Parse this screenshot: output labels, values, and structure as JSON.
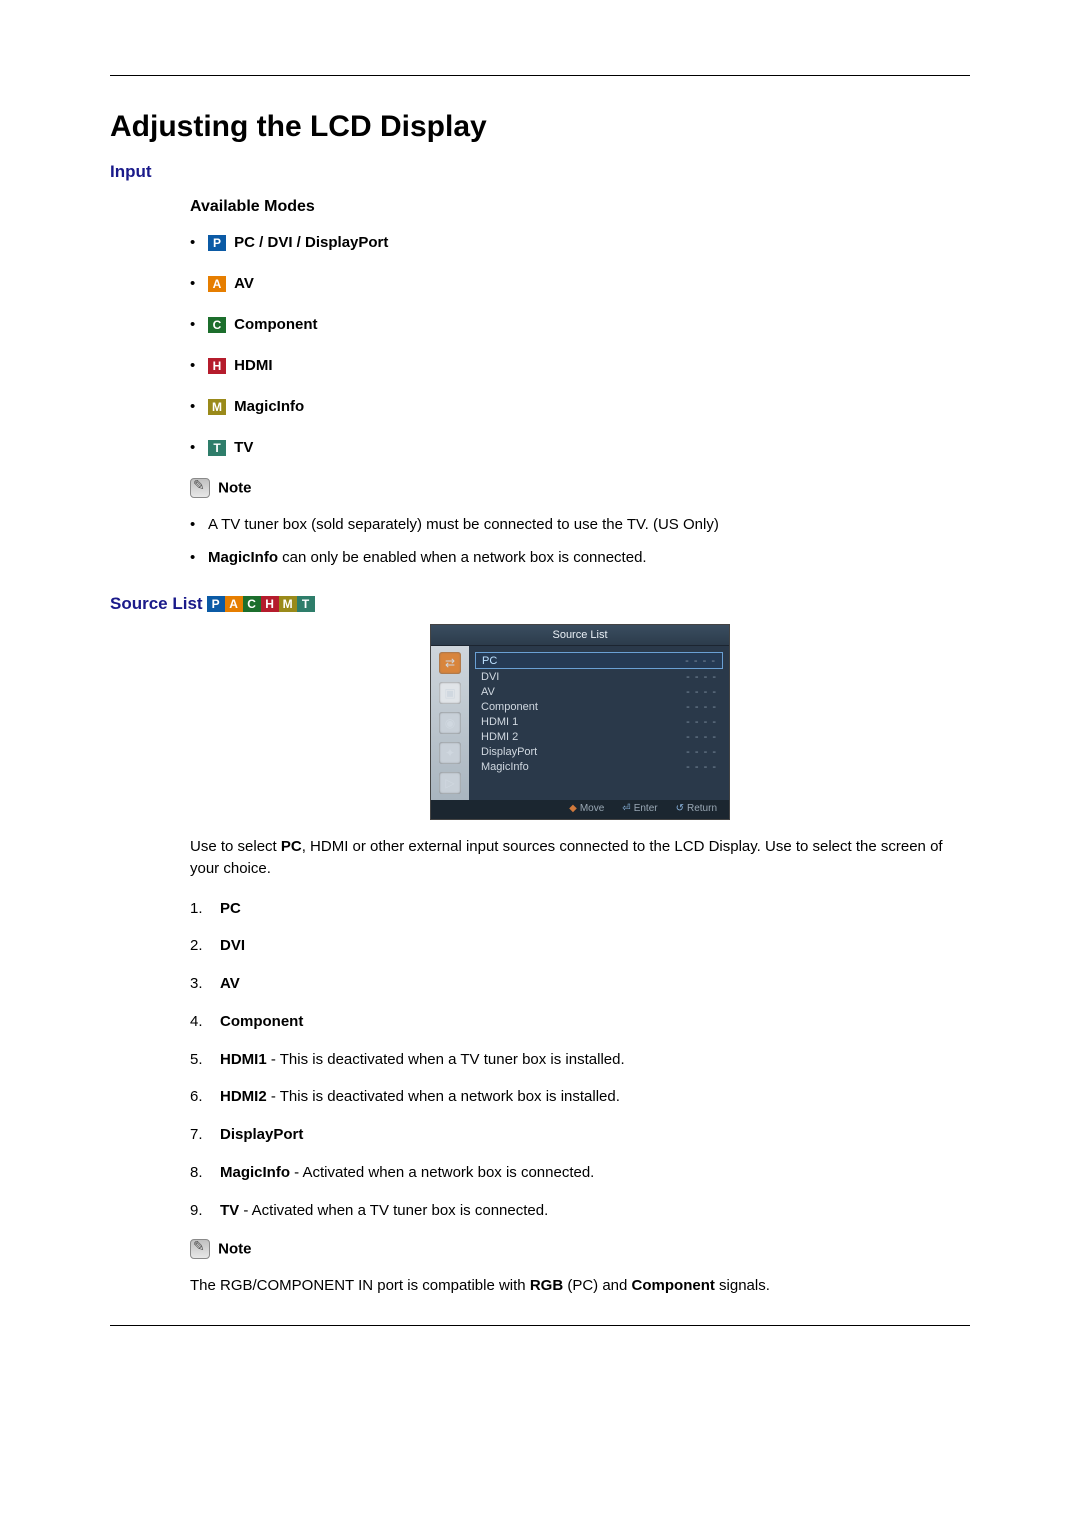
{
  "page_title": "Adjusting the LCD Display",
  "sections": {
    "input": {
      "heading": "Input",
      "available_modes_heading": "Available Modes",
      "modes": [
        {
          "badge": "P",
          "class": "b-P",
          "label": "PC / DVI / DisplayPort"
        },
        {
          "badge": "A",
          "class": "b-A",
          "label": "AV"
        },
        {
          "badge": "C",
          "class": "b-C",
          "label": "Component"
        },
        {
          "badge": "H",
          "class": "b-H",
          "label": "HDMI"
        },
        {
          "badge": "M",
          "class": "b-M",
          "label": "MagicInfo"
        },
        {
          "badge": "T",
          "class": "b-T",
          "label": "TV"
        }
      ],
      "note_label": "Note",
      "notes": [
        {
          "plain": "A TV tuner box (sold separately) must be connected to use the TV. (US Only)"
        },
        {
          "bold_prefix": "MagicInfo",
          "rest": " can only be enabled when a network box is connected."
        }
      ]
    },
    "source_list": {
      "heading": "Source List",
      "badges": [
        "P",
        "A",
        "C",
        "H",
        "M",
        "T"
      ],
      "osd": {
        "title": "Source List",
        "items": [
          {
            "label": "PC",
            "value": "- - - -",
            "selected": true
          },
          {
            "label": "DVI",
            "value": "- - - -",
            "selected": false
          },
          {
            "label": "AV",
            "value": "- - - -",
            "selected": false
          },
          {
            "label": "Component",
            "value": "- - - -",
            "selected": false
          },
          {
            "label": "HDMI 1",
            "value": "- - - -",
            "selected": false
          },
          {
            "label": "HDMI 2",
            "value": "- - - -",
            "selected": false
          },
          {
            "label": "DisplayPort",
            "value": "- - - -",
            "selected": false
          },
          {
            "label": "MagicInfo",
            "value": "- - - -",
            "selected": false
          }
        ],
        "footer": {
          "move": "Move",
          "enter": "Enter",
          "return": "Return"
        }
      },
      "description_pre": "Use to select ",
      "description_bold": "PC",
      "description_post": ", HDMI or other external input sources connected to the LCD Display. Use to select the screen of your choice.",
      "list": [
        {
          "bold": "PC",
          "rest": ""
        },
        {
          "bold": "DVI",
          "rest": ""
        },
        {
          "bold": "AV",
          "rest": ""
        },
        {
          "bold": "Component",
          "rest": ""
        },
        {
          "bold": "HDMI1",
          "rest": " - This is deactivated when a TV tuner box is installed."
        },
        {
          "bold": "HDMI2",
          "rest": " - This is deactivated when a network box is installed."
        },
        {
          "bold": "DisplayPort",
          "rest": ""
        },
        {
          "bold": "MagicInfo",
          "rest": " - Activated when a network box is connected."
        },
        {
          "bold": "TV",
          "rest": " - Activated when a TV tuner box is connected."
        }
      ],
      "note_label": "Note",
      "note2_pre": "The RGB/COMPONENT IN port is compatible with ",
      "note2_b1": "RGB",
      "note2_mid": " (PC) and ",
      "note2_b2": "Component",
      "note2_post": " signals."
    }
  }
}
